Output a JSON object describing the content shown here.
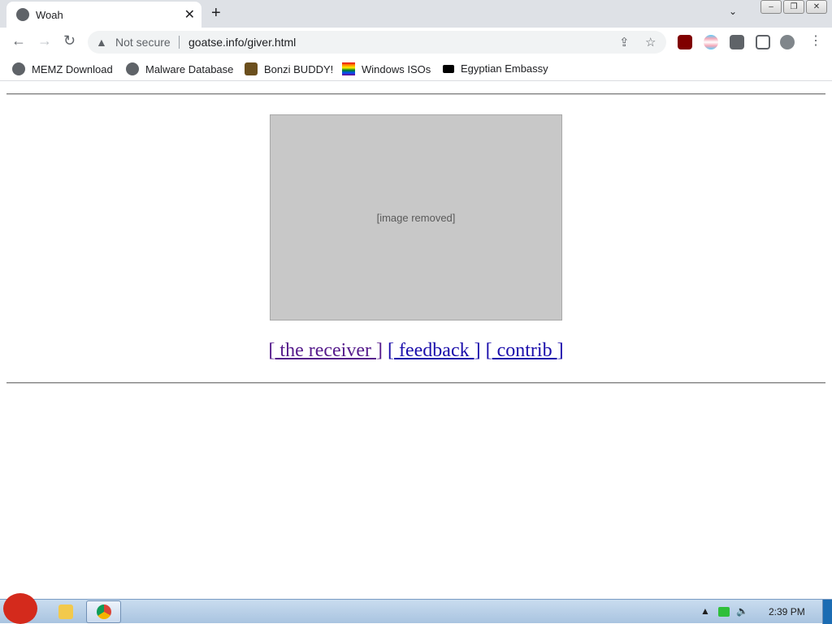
{
  "browser": {
    "tab_title": "Woah",
    "tab_close": "✕",
    "new_tab": "+",
    "tab_menu": "⌄",
    "window_buttons": [
      "–",
      "❐",
      "✕"
    ],
    "nav": {
      "back": "←",
      "forward": "→",
      "reload": "↻"
    },
    "security_icon": "▲",
    "security_text": "Not secure",
    "url": "goatse.info/giver.html",
    "share_icon": "⇪",
    "star_icon": "☆",
    "menu_icon": "⋮"
  },
  "bookmarks": [
    {
      "label": "MEMZ Download",
      "icon": "globe-icon"
    },
    {
      "label": "Malware Database",
      "icon": "globe-icon"
    },
    {
      "label": "Bonzi BUDDY!",
      "icon": "bonzi-icon"
    },
    {
      "label": "Windows ISOs",
      "icon": "rainbow-flag-icon"
    },
    {
      "label": "Egyptian Embassy",
      "icon": "wix-icon"
    }
  ],
  "page": {
    "image_placeholder": "[image removed]",
    "links": [
      {
        "label": " the receiver ",
        "state": "visited"
      },
      {
        "label": " feedback ",
        "state": "unvisited"
      },
      {
        "label": " contrib ",
        "state": "unvisited"
      }
    ],
    "bracket_open": "[",
    "bracket_close": "]"
  },
  "taskbar": {
    "clock": "2:39 PM",
    "tray_arrow": "▲",
    "volume_icon": "🔈"
  },
  "colors": {
    "link": "#1a0dab",
    "link_visited": "#551a8b",
    "taskbar": "#a9c4e0"
  }
}
